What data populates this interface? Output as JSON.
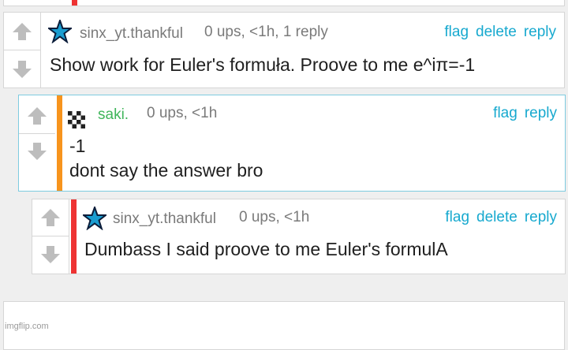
{
  "colors": {
    "accent_blue": "#17a9cf",
    "red_bar": "#ee3333",
    "orange_bar": "#f7941d",
    "saki_green": "#3fb55a",
    "card_border_highlight": "#7ecbe0"
  },
  "comments": [
    {
      "id": "c1",
      "username": "sinx_yt.thankful",
      "avatar_icon": "star-icon",
      "meta": "0 ups, <1h, 1 reply",
      "actions": [
        "flag",
        "delete",
        "reply"
      ],
      "lines": [
        "Show work for Euler's formuła. Proove to me e^iπ=-1"
      ]
    },
    {
      "id": "c2",
      "username": "saki.",
      "avatar_icon": "pixel-avatar-icon",
      "meta": "0 ups, <1h",
      "actions": [
        "flag",
        "reply"
      ],
      "lines": [
        "-1",
        "dont say the answer bro"
      ]
    },
    {
      "id": "c3",
      "username": "sinx_yt.thankful",
      "avatar_icon": "star-icon",
      "meta": "0 ups, <1h",
      "actions": [
        "flag",
        "delete",
        "reply"
      ],
      "lines": [
        "Dumbass I said proove to me Euler's formulA"
      ]
    }
  ],
  "footer": {
    "watermark": "imgflip.com"
  }
}
